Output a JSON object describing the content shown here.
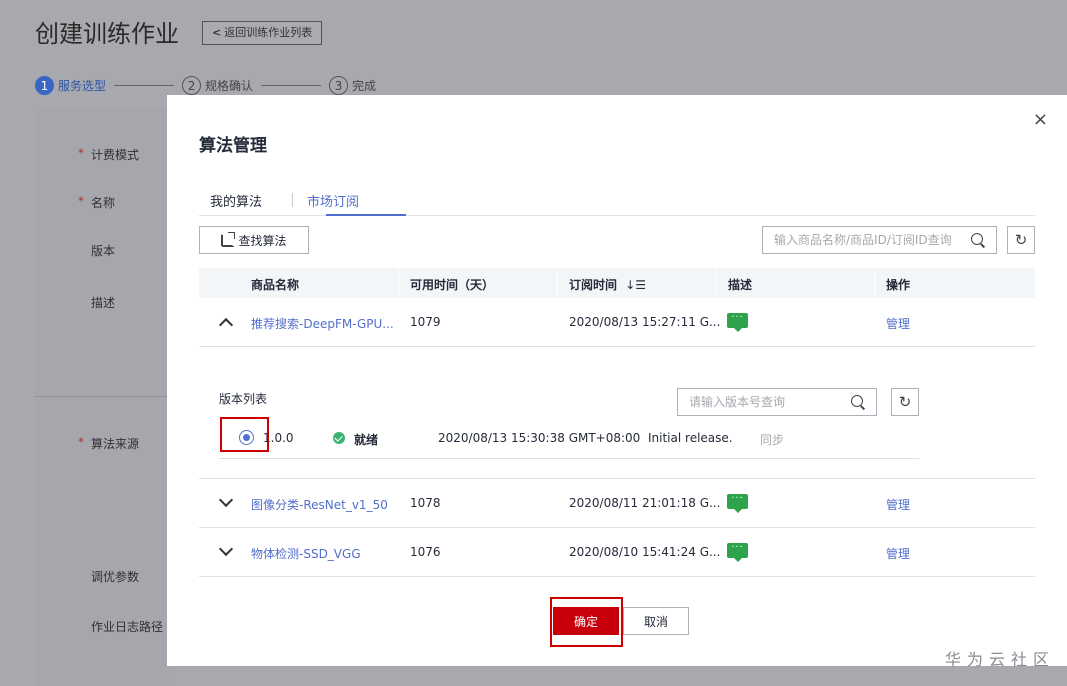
{
  "background": {
    "page_title": "创建训练作业",
    "back_button": "返回训练作业列表",
    "steps": [
      {
        "num": "1",
        "label": "服务选型"
      },
      {
        "num": "2",
        "label": "规格确认"
      },
      {
        "num": "3",
        "label": "完成"
      }
    ],
    "form_labels": {
      "billing": "计费模式",
      "name": "名称",
      "version": "版本",
      "description": "描述",
      "algorithm_source": "算法来源",
      "tuning_params": "调优参数",
      "log_path": "作业日志路径"
    }
  },
  "dialog": {
    "title": "算法管理",
    "close_icon": "×",
    "tabs": [
      "我的算法",
      "市场订阅"
    ],
    "active_tab": 1,
    "find_button": "查找算法",
    "search_placeholder": "输入商品名称/商品ID/订阅ID查询",
    "table": {
      "headers": [
        "商品名称",
        "可用时间（天）",
        "订阅时间",
        "描述",
        "操作"
      ],
      "sort_icon": "↓☰",
      "rows": [
        {
          "name": "推荐搜索-DeepFM-GPU...",
          "days": "1079",
          "time": "2020/08/13 15:27:11 G...",
          "action": "管理",
          "expanded": true
        },
        {
          "name": "图像分类-ResNet_v1_50",
          "days": "1078",
          "time": "2020/08/11 21:01:18 G...",
          "action": "管理",
          "expanded": false
        },
        {
          "name": "物体检测-SSD_VGG",
          "days": "1076",
          "time": "2020/08/10 15:41:24 G...",
          "action": "管理",
          "expanded": false
        }
      ]
    },
    "version_list": {
      "title": "版本列表",
      "search_placeholder": "请输入版本号查询",
      "item": {
        "version": "1.0.0",
        "status": "就绪",
        "time": "2020/08/13 15:30:38 GMT+08:00",
        "note": "Initial release.",
        "sync": "同步"
      }
    },
    "ok_button": "确定",
    "cancel_button": "取消"
  },
  "watermark": "华为云社区",
  "colors": {
    "brand_red": "#c7000b",
    "link_blue": "#526ecc",
    "status_green": "#3cb371"
  }
}
